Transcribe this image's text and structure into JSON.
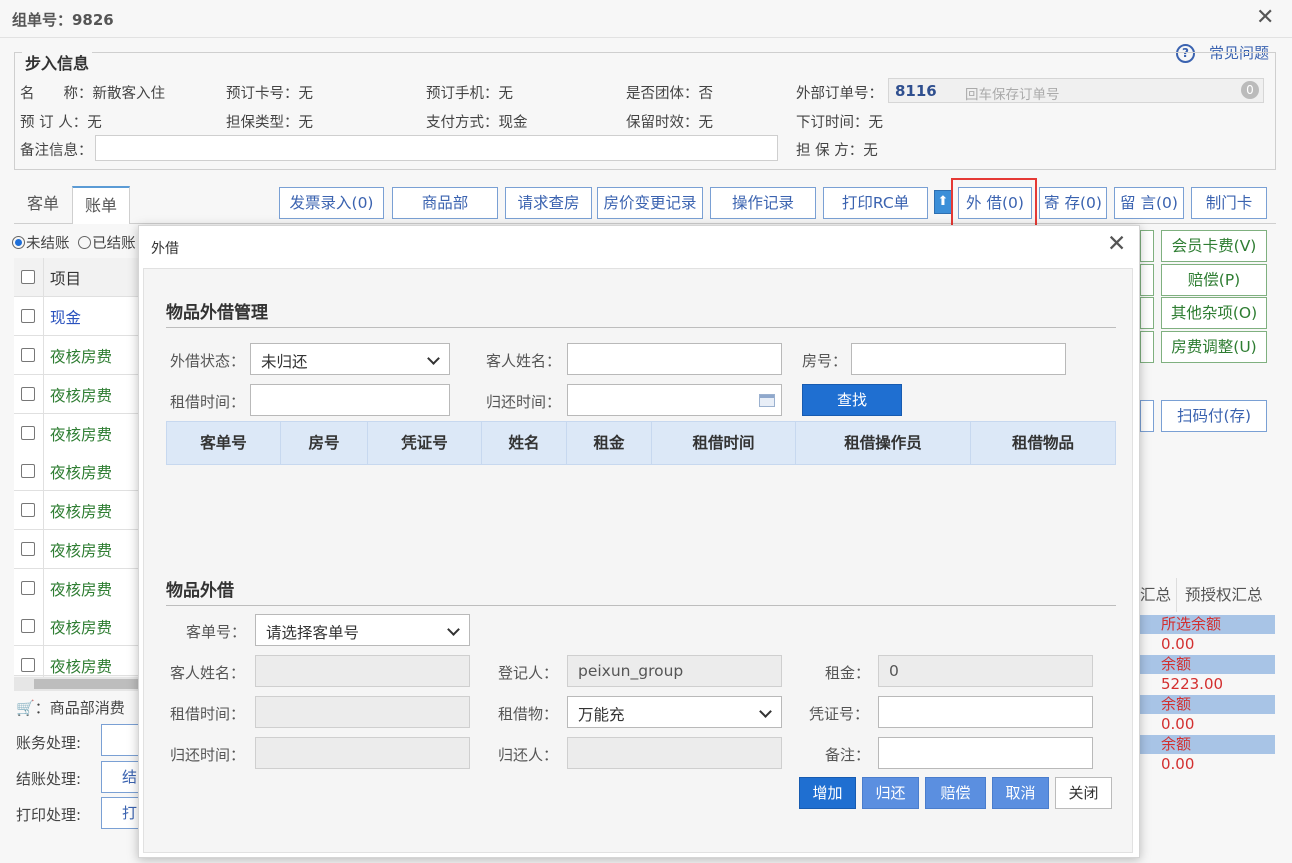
{
  "window": {
    "title": "组单号：9826",
    "help": "常见问题"
  },
  "checkin_info": {
    "legend": "步入信息",
    "name_label": "名　　称：",
    "name": "新散客入住",
    "booking_card_label": "预订卡号：",
    "booking_card": "无",
    "booking_phone_label": "预订手机：",
    "booking_phone": "无",
    "is_group_label": "是否团体：",
    "is_group": "否",
    "external_order_label": "外部订单号：",
    "external_order": "8116",
    "external_order_placeholder": "回车保存订单号",
    "external_order_badge": "0",
    "booker_label": "预 订 人：",
    "booker": "无",
    "guarantee_type_label": "担保类型：",
    "guarantee_type": "无",
    "payment_label": "支付方式：",
    "payment": "现金",
    "hold_label": "保留时效：",
    "hold": "无",
    "order_time_label": "下订时间：",
    "order_time": "无",
    "note_label": "备注信息：",
    "guarantor_label": "担 保 方：",
    "guarantor": "无"
  },
  "tabs": [
    "客单",
    "账单"
  ],
  "toolbar": {
    "invoice": "发票录入(0)",
    "goods": "商品部",
    "check_room": "请求查房",
    "price_change": "房价变更记录",
    "operation_log": "操作记录",
    "print_rc": "打印RC单",
    "lend": "外 借(0)",
    "deposit": "寄 存(0)",
    "message": "留 言(0)",
    "door_card": "制门卡"
  },
  "side_buttons": {
    "member_fee": "会员卡费(V)",
    "compensate": "赔偿(P)",
    "misc": "其他杂项(O)",
    "room_adjust": "房费调整(U)",
    "scan_pay": "扫码付(存)"
  },
  "radios": {
    "unsettled": "未结账",
    "settled": "已结账"
  },
  "bill_table": {
    "header": "项目",
    "rows": [
      "现金",
      "夜核房费",
      "夜核房费",
      "夜核房费",
      "夜核房费",
      "夜核房费",
      "夜核房费",
      "夜核房费",
      "夜核房费",
      "夜核房费"
    ]
  },
  "bottom_left": {
    "goods_consumption": "商品部消费",
    "account_label": "账务处理:",
    "settle_label": "结账处理:",
    "settle_btn": "结",
    "print_label": "打印处理:",
    "print_btn": "打"
  },
  "right_summary": {
    "tab_summary": "汇总",
    "tab_preauth": "预授权汇总",
    "selected_balance_label": "所选余额",
    "selected_balance": "0.00",
    "balance_label_1": "余额",
    "balance_1": "5223.00",
    "balance_label_2": "余额",
    "balance_2": "0.00",
    "balance_label_3": "余额",
    "balance_3": "0.00"
  },
  "modal": {
    "title": "外借",
    "section1_title": "物品外借管理",
    "status_label": "外借状态：",
    "status_value": "未归还",
    "guest_name_label": "客人姓名：",
    "room_label": "房号：",
    "rent_time_label": "租借时间：",
    "return_time_label": "归还时间：",
    "search_button": "查找",
    "grid_columns": [
      "客单号",
      "房号",
      "凭证号",
      "姓名",
      "租金",
      "租借时间",
      "租借操作员",
      "租借物品"
    ],
    "section2_title": "物品外借",
    "order_label": "客单号：",
    "order_value": "请选择客单号",
    "f_guest_name_label": "客人姓名：",
    "registrar_label": "登记人：",
    "registrar_value": "peixun_group",
    "rent_label": "租金：",
    "rent_value": "0",
    "f_rent_time_label": "租借时间：",
    "item_label": "租借物：",
    "item_value": "万能充",
    "voucher_label": "凭证号：",
    "f_return_time_label": "归还时间：",
    "returner_label": "归还人：",
    "remark_label": "备注：",
    "buttons": {
      "add": "增加",
      "return": "归还",
      "compensate": "赔偿",
      "cancel": "取消",
      "close": "关闭"
    }
  }
}
